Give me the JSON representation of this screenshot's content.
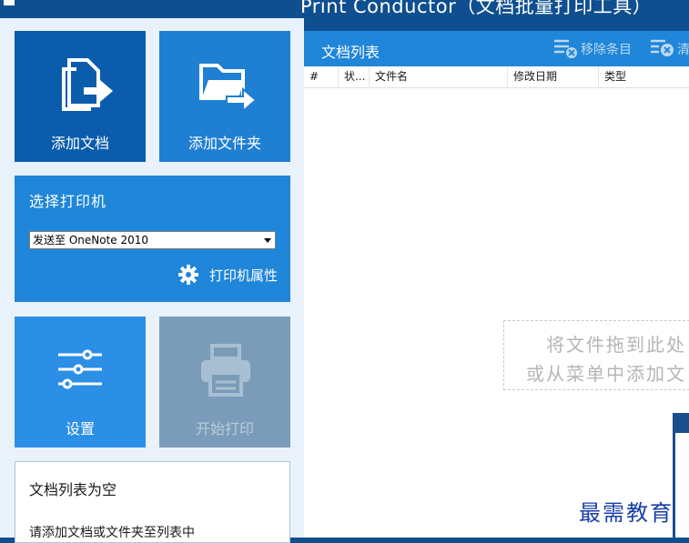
{
  "window": {
    "title": "Print Conductor（文档批量打印工具）"
  },
  "tiles": {
    "add_documents": "添加文档",
    "add_folder": "添加文件夹",
    "settings": "设置",
    "start_print": "开始打印"
  },
  "printer": {
    "title": "选择打印机",
    "selected": "发送至 OneNote 2010",
    "properties": "打印机属性"
  },
  "status": {
    "title": "文档列表为空",
    "hint": "请添加文档或文件夹至列表中"
  },
  "doclist": {
    "title": "文档列表",
    "remove_item": "移除条目",
    "clear": "清",
    "columns": [
      "#",
      "状...",
      "文件名",
      "修改日期",
      "类型"
    ],
    "drop_line1": "将文件拖到此处",
    "drop_line2": "或从菜单中添加文"
  },
  "watermark": "最需教育",
  "colors": {
    "title_bg": "#0f4f8f",
    "tile_dark": "#0b5cad",
    "tile_mid": "#1f86d9",
    "tile_light": "#2b8fe6",
    "tile_disabled": "#7a9cb8",
    "panel_bg": "#e9f2fb"
  }
}
